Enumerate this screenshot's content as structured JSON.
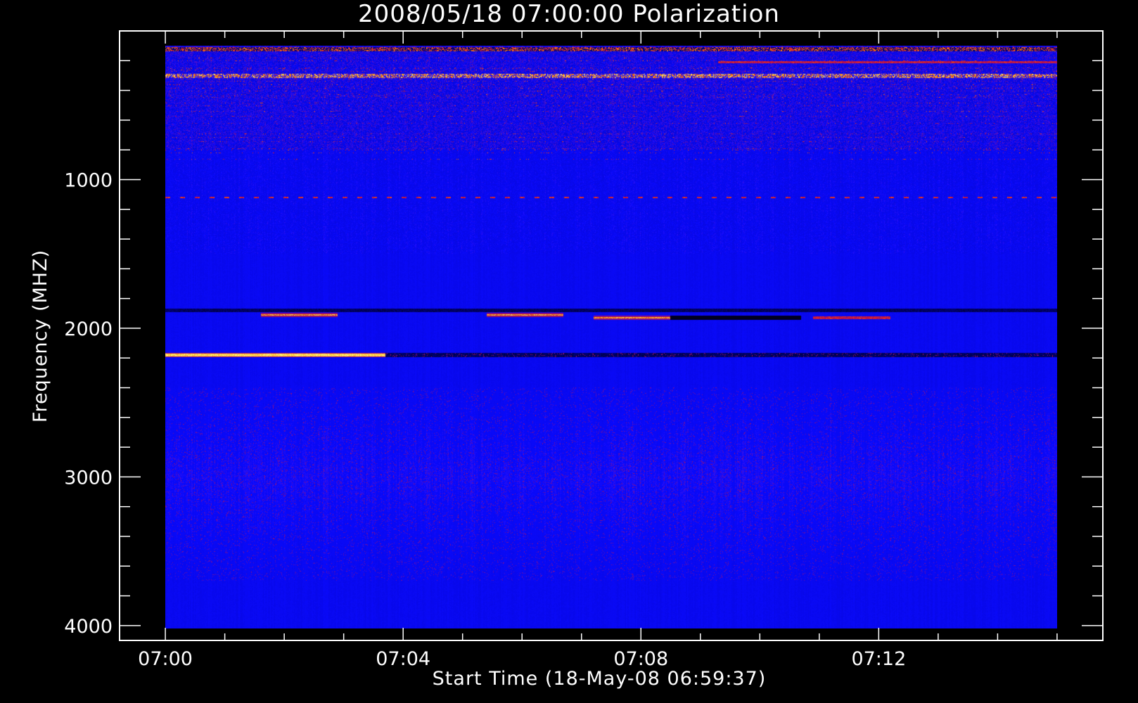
{
  "chart_data": {
    "type": "heatmap",
    "title": "2008/05/18 07:00:00 Polarization",
    "xlabel": "Start Time (18-May-08 06:59:37)",
    "ylabel": "Frequency (MHZ)",
    "x_ticks": [
      {
        "label": "07:00",
        "minutes": 0
      },
      {
        "label": "07:04",
        "minutes": 4
      },
      {
        "label": "07:08",
        "minutes": 8
      },
      {
        "label": "07:12",
        "minutes": 12
      }
    ],
    "x_minor_step_minutes": 1,
    "xlim_minutes": [
      -0.77,
      15.77
    ],
    "data_x_range_minutes": [
      0,
      15
    ],
    "y_ticks": [
      1000,
      2000,
      3000,
      4000
    ],
    "y_minor_step": 200,
    "ylim": [
      4100,
      0
    ],
    "data_y_range": [
      100,
      4020
    ],
    "colormap": {
      "low": "#000000",
      "mid": "#1818ff",
      "high_1": "#cc1010",
      "high_2": "#ff8c00",
      "max": "#ffff80"
    },
    "background_level": "blue",
    "features": [
      {
        "kind": "band",
        "freq_mhz": 120,
        "time_min": [
          0,
          15
        ],
        "intensity": "red/orange, intermittent"
      },
      {
        "kind": "band",
        "freq_mhz": 210,
        "time_min": [
          9.3,
          15
        ],
        "intensity": "red"
      },
      {
        "kind": "band",
        "freq_mhz": 300,
        "time_min": [
          0,
          15
        ],
        "intensity": "yellow speckle"
      },
      {
        "kind": "band",
        "freq_mhz": 1120,
        "time_min": [
          0,
          15
        ],
        "intensity": "red dashes"
      },
      {
        "kind": "band",
        "freq_mhz": 1880,
        "time_min": [
          0,
          15
        ],
        "intensity": "dark"
      },
      {
        "kind": "band",
        "freq_mhz": 1910,
        "time_min": [
          1.6,
          2.9
        ],
        "intensity": "orange/yellow"
      },
      {
        "kind": "band",
        "freq_mhz": 1910,
        "time_min": [
          5.4,
          6.7
        ],
        "intensity": "orange/yellow"
      },
      {
        "kind": "band",
        "freq_mhz": 1930,
        "time_min": [
          7.2,
          8.5
        ],
        "intensity": "orange/yellow"
      },
      {
        "kind": "band",
        "freq_mhz": 1930,
        "time_min": [
          8.5,
          10.7
        ],
        "intensity": "black"
      },
      {
        "kind": "band",
        "freq_mhz": 1930,
        "time_min": [
          10.9,
          12.2
        ],
        "intensity": "red/orange"
      },
      {
        "kind": "band",
        "freq_mhz": 2180,
        "time_min": [
          0,
          3.7
        ],
        "intensity": "yellow saturated"
      },
      {
        "kind": "band",
        "freq_mhz": 2180,
        "time_min": [
          3.7,
          15
        ],
        "intensity": "dark with red flecks"
      }
    ]
  }
}
